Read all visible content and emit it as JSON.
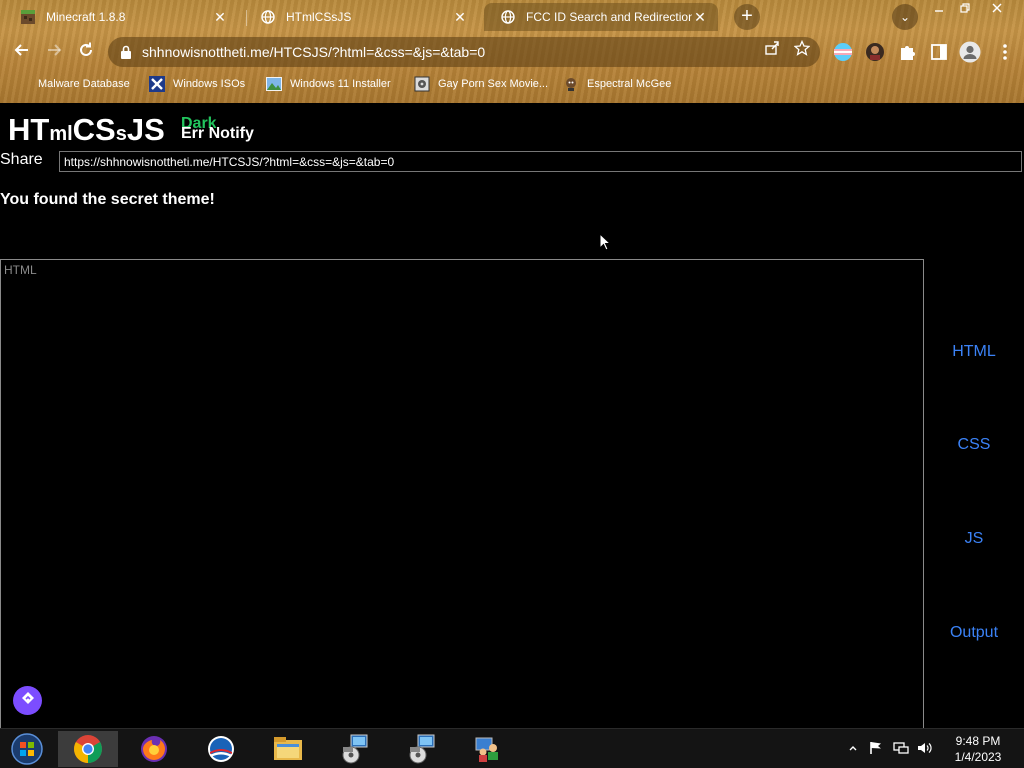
{
  "browser": {
    "tabs": [
      {
        "title": "Minecraft 1.8.8",
        "icon": "minecraft-icon",
        "active": false
      },
      {
        "title": "HTmlCSsJS",
        "icon": "globe-icon",
        "active": false
      },
      {
        "title": "FCC ID Search and Redirection",
        "icon": "globe-icon",
        "active": true
      }
    ],
    "close_glyph": "✕",
    "new_tab_glyph": "+",
    "tab_search_glyph": "⌄",
    "url": "shhnowisnottheti.me/HTCSJS/?html=&css=&js=&tab=0",
    "bookmarks": [
      {
        "label": "Malware Database",
        "icon": "blank-icon"
      },
      {
        "label": "Windows ISOs",
        "icon": "x-logo-icon"
      },
      {
        "label": "Windows 11 Installer",
        "icon": "image-icon"
      },
      {
        "label": "Gay Porn Sex Movie...",
        "icon": "disc-icon"
      },
      {
        "label": "Espectral McGee",
        "icon": "character-icon"
      }
    ]
  },
  "page": {
    "logo": {
      "part1": "HT",
      "part2": "ml",
      "part3": "CS",
      "part4": "s",
      "part5": "JS"
    },
    "dark_label": "Dark",
    "err_notify_label": "Err Notify",
    "share_label": "Share",
    "share_url": "https://shhnowisnottheti.me/HTCSJS/?html=&css=&js=&tab=0",
    "secret_message": "You found the secret theme!",
    "editor_placeholder": "HTML",
    "side_tabs": [
      "HTML",
      "CSS",
      "JS",
      "Output"
    ],
    "colors": {
      "accent_link": "#3b82f6",
      "dark_link": "#22c55e",
      "floating_button": "#7c4dff"
    }
  },
  "taskbar": {
    "apps": [
      "windows-start-icon",
      "chrome-icon",
      "firefox-icon",
      "obama-logo-icon",
      "file-explorer-icon",
      "installer-icon",
      "installer-icon",
      "network-people-icon"
    ],
    "time": "9:48 PM",
    "date": "1/4/2023"
  }
}
